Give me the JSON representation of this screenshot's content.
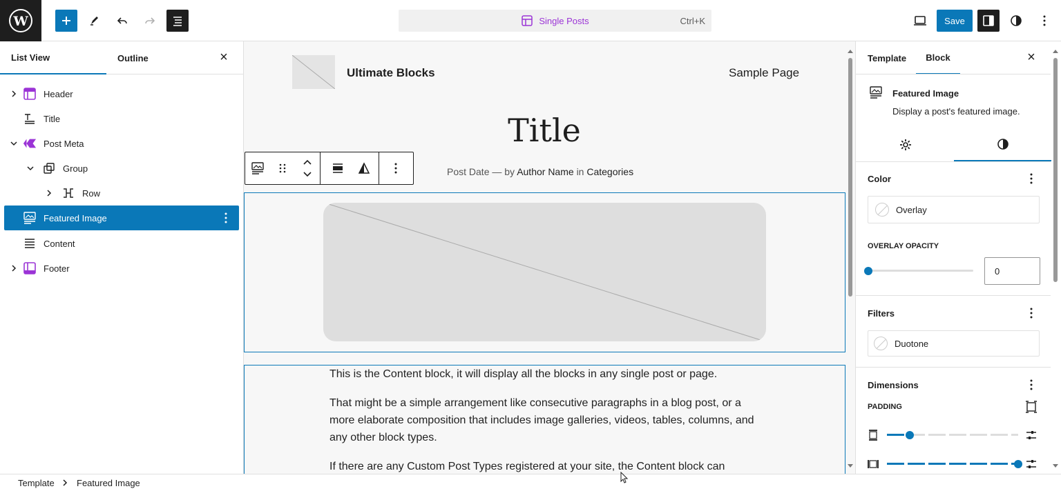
{
  "topbar": {
    "command_title": "Single Posts",
    "command_shortcut": "Ctrl+K",
    "save_label": "Save",
    "icons": [
      "wordpress-logo",
      "plus-icon",
      "pen-icon",
      "undo-icon",
      "redo-icon",
      "list-view-icon",
      "desktop-preview-icon",
      "settings-sidebar-icon",
      "styles-contrast-icon",
      "more-vertical-icon"
    ]
  },
  "left_panel": {
    "tabs": [
      "List View",
      "Outline"
    ],
    "items": [
      {
        "label": "Header",
        "icon": "template-part-header-icon",
        "expandable": true
      },
      {
        "label": "Title",
        "icon": "title-icon"
      },
      {
        "label": "Post Meta",
        "icon": "pattern-diamond-icon",
        "expanded": true
      },
      {
        "label": "Group",
        "icon": "group-icon",
        "expanded": true
      },
      {
        "label": "Row",
        "icon": "row-icon",
        "expandable": true
      },
      {
        "label": "Featured Image",
        "icon": "featured-image-icon",
        "selected": true
      },
      {
        "label": "Content",
        "icon": "content-lines-icon"
      },
      {
        "label": "Footer",
        "icon": "template-part-footer-icon",
        "expandable": true
      }
    ]
  },
  "canvas": {
    "site_title": "Ultimate Blocks",
    "nav_link": "Sample Page",
    "post_title": "Title",
    "meta": {
      "date": "Post Date",
      "sep": "— by",
      "author": "Author Name",
      "in": "in",
      "categories": "Categories"
    },
    "content_paragraphs": [
      "This is the Content block, it will display all the blocks in any single post or page.",
      "That might be a simple arrangement like consecutive paragraphs in a blog post, or a more elaborate composition that includes image galleries, videos, tables, columns, and any other block types.",
      "If there are any Custom Post Types registered at your site, the Content block can"
    ]
  },
  "right_panel": {
    "tabs": [
      "Template",
      "Block"
    ],
    "active_tab": "Block",
    "block_name": "Featured Image",
    "block_desc": "Display a post's featured image.",
    "color_title": "Color",
    "overlay_label": "Overlay",
    "overlay_opacity_label": "OVERLAY OPACITY",
    "overlay_opacity_value": "0",
    "filters_title": "Filters",
    "duotone_label": "Duotone",
    "dimensions_title": "Dimensions",
    "padding_label": "PADDING",
    "padding_top_level": 0.16,
    "padding_side_level": 1.0
  },
  "footer": {
    "crumbs": [
      "Template",
      "Featured Image"
    ]
  },
  "colors": {
    "accent": "#0a78b8",
    "command": "#9b34d6",
    "dark": "#1e1e1e"
  }
}
